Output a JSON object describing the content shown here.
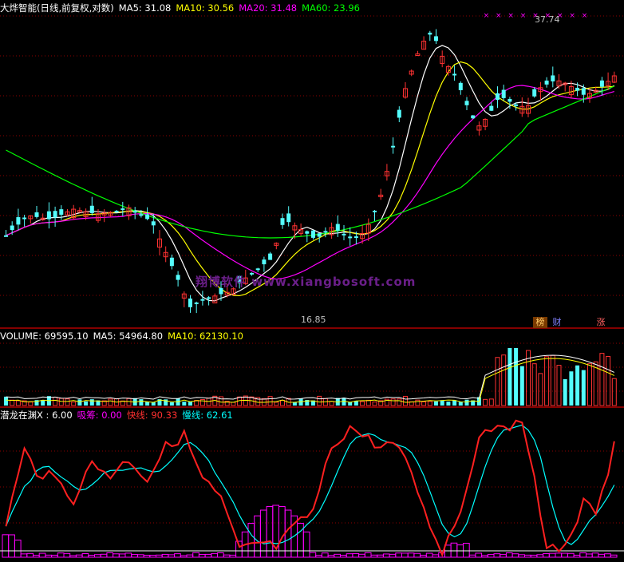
{
  "main_panel": {
    "title": "大烨智能(日线,前复权,对数)",
    "ma5": {
      "label": "MA5: 31.08",
      "color": "#ffffff"
    },
    "ma10": {
      "label": "MA10: 30.56",
      "color": "#ffff00"
    },
    "ma20": {
      "label": "MA20: 31.48",
      "color": "#ff00ff"
    },
    "ma60": {
      "label": "MA60: 23.96",
      "color": "#00ff00"
    },
    "high_label": "37.74",
    "low_label": "16.85",
    "tags": [
      "榜",
      "财",
      "涨"
    ]
  },
  "volume_panel": {
    "volume": {
      "label": "VOLUME: 69595.10",
      "color": "#ffffff"
    },
    "ma5": {
      "label": "MA5: 54964.80",
      "color": "#ffffff"
    },
    "ma10": {
      "label": "MA10: 62130.10",
      "color": "#ffff00"
    }
  },
  "indicator_panel": {
    "name": {
      "label": "潜龙在渊X : 6.00",
      "color": "#ffffff"
    },
    "xichou": {
      "label": "吸筹: 0.00",
      "color": "#ff00ff"
    },
    "kuaixian": {
      "label": "快线: 90.33",
      "color": "#ff3030"
    },
    "manxian": {
      "label": "慢线: 62.61",
      "color": "#00ffff"
    }
  },
  "watermark": "翔博软件 www.xiangbosoft.com",
  "colors": {
    "up": "#ff3232",
    "down": "#54fcfc",
    "grid": "#8b0000",
    "marker": "#ff00ff"
  }
}
